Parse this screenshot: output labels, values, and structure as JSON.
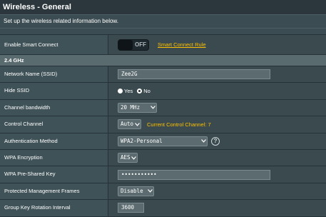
{
  "header": {
    "title": "Wireless - General",
    "description": "Set up the wireless related information below."
  },
  "smart_connect": {
    "label": "Enable Smart Connect",
    "toggle_state": "OFF",
    "rule_link": "Smart Connect Rule"
  },
  "band": {
    "title": "2.4 GHz"
  },
  "fields": {
    "ssid": {
      "label": "Network Name (SSID)",
      "value": "Zee2G"
    },
    "hide_ssid": {
      "label": "Hide SSID",
      "yes": "Yes",
      "no": "No",
      "selected": "No"
    },
    "bandwidth": {
      "label": "Channel bandwidth",
      "value": "20 MHz"
    },
    "control_channel": {
      "label": "Control Channel",
      "value": "Auto",
      "current": "Current Control Channel: 7"
    },
    "auth_method": {
      "label": "Authentication Method",
      "value": "WPA2-Personal"
    },
    "encryption": {
      "label": "WPA Encryption",
      "value": "AES"
    },
    "psk": {
      "label": "WPA Pre-Shared Key",
      "value": "•••••••••••"
    },
    "pmf": {
      "label": "Protected Management Frames",
      "value": "Disable"
    },
    "gk_rotation": {
      "label": "Group Key Rotation Interval",
      "value": "3600"
    }
  },
  "colors": {
    "accent": "#ffc000",
    "background": "#3b4c52",
    "header": "#2b373c"
  },
  "icons": {
    "chevron": "chevron-down-icon",
    "help": "help-icon"
  }
}
